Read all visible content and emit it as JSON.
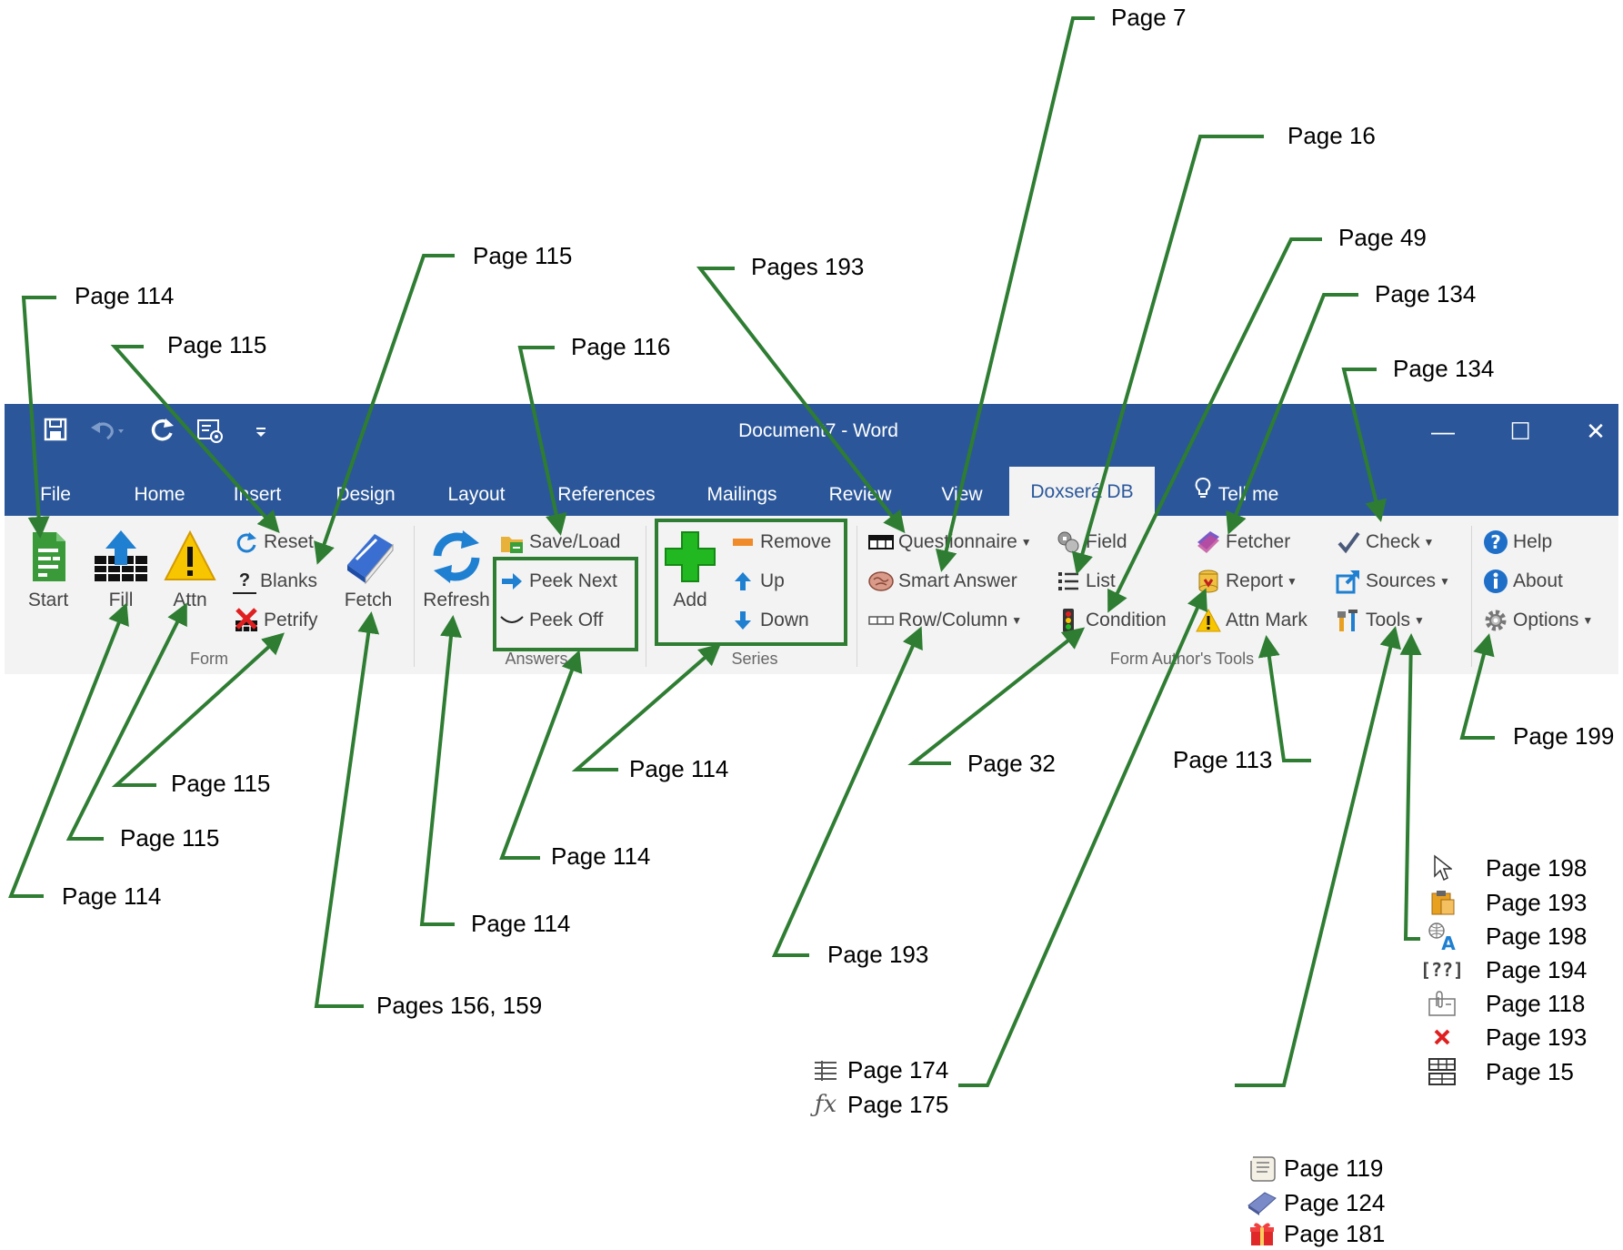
{
  "window": {
    "title": "Document7  -  Word",
    "controls": {
      "minimize": "—",
      "maximize": "☐",
      "close": "✕"
    }
  },
  "quick_access": {
    "save_icon": "save-icon",
    "undo_icon": "undo-icon",
    "redo_icon": "redo-icon",
    "customize_icon": "customize-icon",
    "more_icon": "qat-more-icon"
  },
  "tabs": [
    "File",
    "Home",
    "Insert",
    "Design",
    "Layout",
    "References",
    "Mailings",
    "Review",
    "View",
    "Doxserá DB",
    "Tell me"
  ],
  "active_tab": "Doxserá DB",
  "ribbon": {
    "groups": {
      "form": "Form",
      "answers": "Answers",
      "series": "Series",
      "form_authors_tools": "Form Author's Tools"
    },
    "form": {
      "start": "Start",
      "fill": "Fill",
      "attn": "Attn",
      "reset": "Reset",
      "blanks": "Blanks",
      "petrify": "Petrify",
      "fetch": "Fetch"
    },
    "answers": {
      "refresh": "Refresh",
      "save_load": "Save/Load",
      "peek_next": "Peek Next",
      "peek_off": "Peek Off"
    },
    "series": {
      "add": "Add",
      "remove": "Remove",
      "up": "Up",
      "down": "Down"
    },
    "tools": {
      "questionnaire": "Questionnaire",
      "smart_answer": "Smart Answer",
      "row_column": "Row/Column",
      "field": "Field",
      "list": "List",
      "condition": "Condition",
      "fetcher": "Fetcher",
      "report": "Report",
      "attn_mark": "Attn Mark",
      "check": "Check",
      "sources": "Sources",
      "tools": "Tools"
    },
    "help": {
      "help": "Help",
      "about": "About",
      "options": "Options"
    }
  },
  "annotations": {
    "a_start": "Page 114",
    "a_reset": "Page 115",
    "a_blanks": "Page 115",
    "a_save_load": "Page 116",
    "a_questionnaire": "Pages 193",
    "a_field": "Page 7",
    "a_list": "Page 16",
    "a_condition": "Page 49",
    "a_fetcher": "Page 134",
    "a_check": "Page 134",
    "a_series": "Page 114",
    "a_row_column": "Page 32",
    "a_attn_mark": "Page 113",
    "a_options": "Page 199",
    "a_petrify": "Page 115",
    "a_attn": "Page 115",
    "a_fill": "Page 114",
    "a_peek": "Page 114",
    "a_refresh": "Page 114",
    "a_smart_answer": "Page 193",
    "a_fetch": "Pages 156, 159"
  },
  "row_column_submenu": [
    {
      "icon": "rows-icon",
      "text": "Page 174"
    },
    {
      "icon": "function-fx-icon",
      "text": "Page 175"
    }
  ],
  "tools_submenu": [
    {
      "icon": "pointer-icon",
      "text": "Page 198"
    },
    {
      "icon": "clipboard-icon",
      "text": "Page 193"
    },
    {
      "icon": "globe-language-icon",
      "text": "Page 198"
    },
    {
      "icon": "bracket-question-icon",
      "text": "Page 194"
    },
    {
      "icon": "paperclip-icon",
      "text": "Page 118"
    },
    {
      "icon": "red-x-icon",
      "text": "Page 193"
    },
    {
      "icon": "table-grid-icon",
      "text": "Page 15"
    }
  ],
  "report_submenu": [
    {
      "icon": "scroll-icon",
      "text": "Page 119"
    },
    {
      "icon": "book-icon",
      "text": "Page 124"
    },
    {
      "icon": "gift-icon",
      "text": "Page 181"
    }
  ],
  "colors": {
    "title_bar": "#2b579a",
    "ribbon": "#f3f3f3",
    "annotation_green": "#2e7d32"
  }
}
